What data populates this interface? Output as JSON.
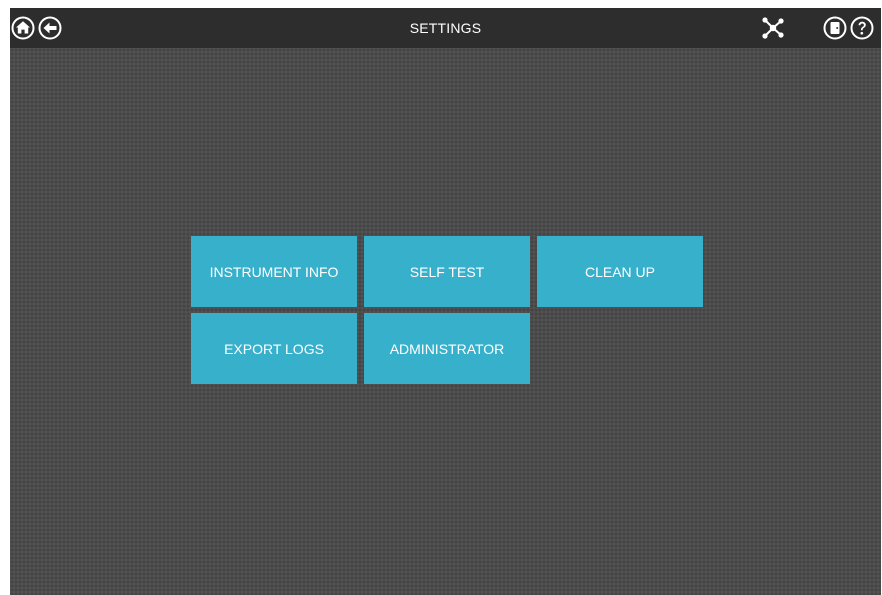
{
  "header": {
    "title": "SETTINGS"
  },
  "icons": {
    "home": "home-icon",
    "back": "back-arrow-icon",
    "network": "network-icon",
    "exit": "exit-door-icon",
    "help": "help-icon"
  },
  "colors": {
    "background": "#4c4c4c",
    "topbar": "#2d2d2d",
    "tile": "#37b0cc",
    "text": "#ffffff"
  },
  "tiles": [
    {
      "label": "INSTRUMENT INFO"
    },
    {
      "label": "SELF TEST"
    },
    {
      "label": "CLEAN UP"
    },
    {
      "label": "EXPORT LOGS"
    },
    {
      "label": "ADMINISTRATOR"
    }
  ]
}
